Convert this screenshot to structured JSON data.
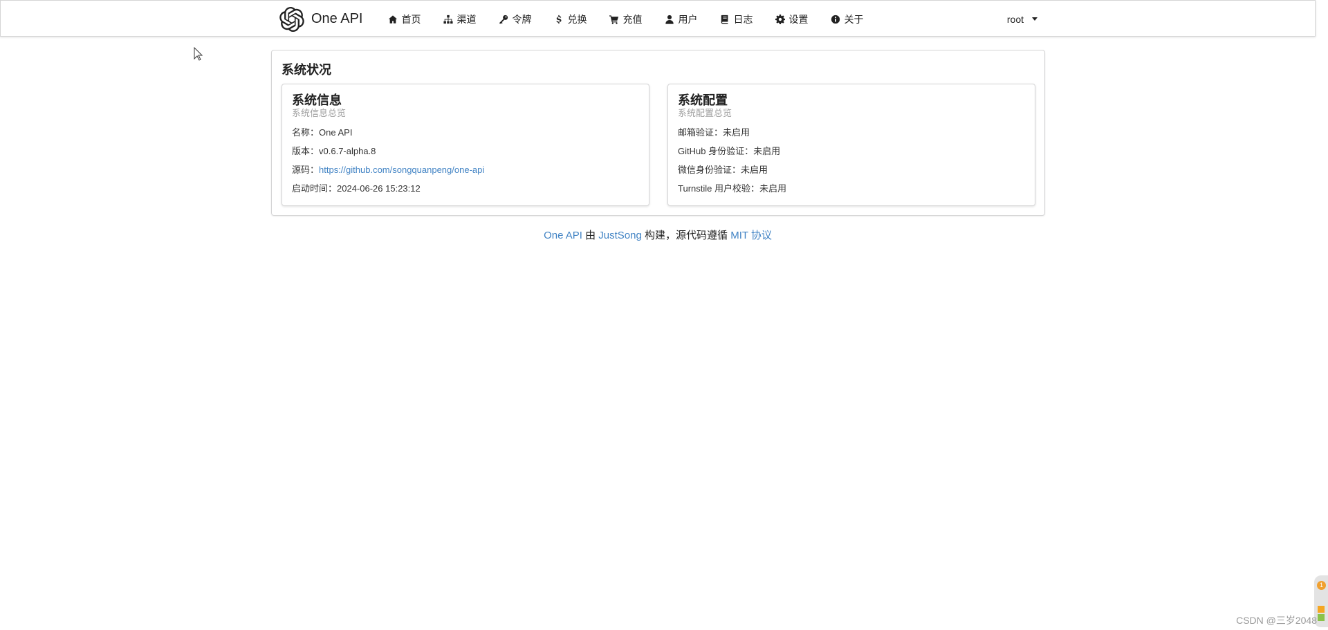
{
  "brand": {
    "name": "One API",
    "logo_icon": "openai-logo-icon"
  },
  "nav": [
    {
      "label": "首页",
      "icon": "home-icon"
    },
    {
      "label": "渠道",
      "icon": "sitemap-icon"
    },
    {
      "label": "令牌",
      "icon": "key-icon"
    },
    {
      "label": "兑换",
      "icon": "dollar-icon"
    },
    {
      "label": "充值",
      "icon": "cart-icon"
    },
    {
      "label": "用户",
      "icon": "user-icon"
    },
    {
      "label": "日志",
      "icon": "book-icon"
    },
    {
      "label": "设置",
      "icon": "gear-icon"
    },
    {
      "label": "关于",
      "icon": "info-icon"
    }
  ],
  "user_menu": {
    "label": "root"
  },
  "status": {
    "title": "系统状况",
    "info": {
      "title": "系统信息",
      "meta": "系统信息总览",
      "name_label": "名称：",
      "name": "One API",
      "version_label": "版本：",
      "version": "v0.6.7-alpha.8",
      "source_label": "源码：",
      "source": "https://github.com/songquanpeng/one-api",
      "start_label": "启动时间：",
      "start_time": "2024-06-26 15:23:12"
    },
    "config": {
      "title": "系统配置",
      "meta": "系统配置总览",
      "email_label": "邮箱验证：",
      "email": "未启用",
      "github_label": "GitHub 身份验证：",
      "github": "未启用",
      "wechat_label": "微信身份验证：",
      "wechat": "未启用",
      "turnstile_label": "Turnstile 用户校验：",
      "turnstile": "未启用"
    }
  },
  "footer": {
    "project": "One API",
    "by": "由",
    "author": "JustSong",
    "built": "构建，源代码遵循",
    "license": "MIT 协议"
  },
  "watermark": "CSDN @三岁2048",
  "side_widget": {
    "badge": "1"
  },
  "colors": {
    "link": "#4183c4",
    "border": "#d4d4d5",
    "meta": "#a0a0a0"
  }
}
